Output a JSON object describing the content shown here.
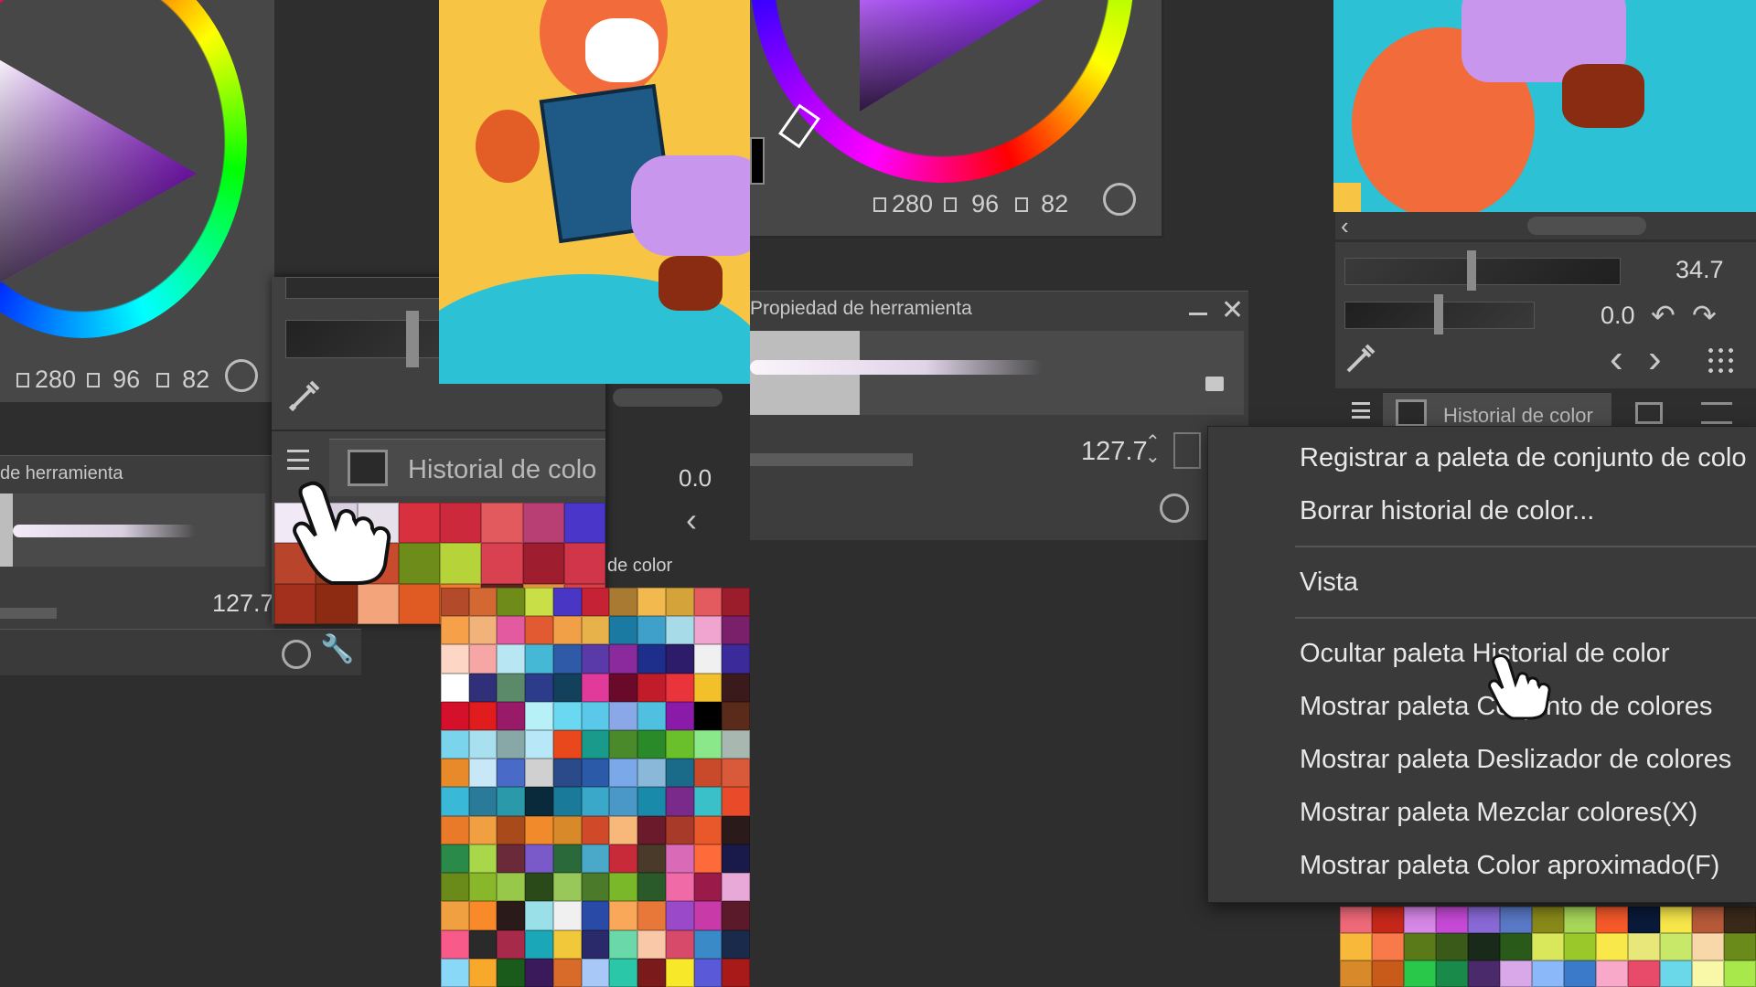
{
  "colors": {
    "panel": "#454545",
    "panel_dark": "#2f2f2f",
    "menu_bg": "#3a3a3a",
    "text": "#d8d8d8",
    "hsv_hue_ring": "conic",
    "accent_purple": "#9b2cf0"
  },
  "left_pane": {
    "color_stats": {
      "a": "280",
      "b": "96",
      "c": "82"
    },
    "tool_property_title": "de herramienta",
    "brush_size": "127.7",
    "history_tab_label": "Historial de colo",
    "color_history_tab_small": "de color",
    "opacity_value": "0.0",
    "icons": [
      "menu-icon",
      "film-icon",
      "eyedropper-icon",
      "timer-icon",
      "wrench-icon",
      "pointer-hand-icon"
    ]
  },
  "right_pane": {
    "color_stats": {
      "a": "280",
      "b": "96",
      "c": "82"
    },
    "tool_property_title": "Propiedad de herramienta",
    "brush_size": "127.7",
    "zoom_value": "34.7",
    "rotate_value": "0.0",
    "history_tab_label": "Historial de color",
    "context_menu": {
      "items": [
        {
          "label": "Registrar a paleta de conjunto de colo"
        },
        {
          "label": "Borrar historial de color..."
        },
        {
          "label": "Vista"
        },
        {
          "label": "Ocultar paleta Historial de color"
        },
        {
          "label": "Mostrar paleta Conjunto de colores"
        },
        {
          "label": "Mostrar paleta Deslizador de colores"
        },
        {
          "label": "Mostrar paleta Mezclar colores(X)"
        },
        {
          "label": "Mostrar paleta Color aproximado(F)"
        }
      ]
    }
  }
}
